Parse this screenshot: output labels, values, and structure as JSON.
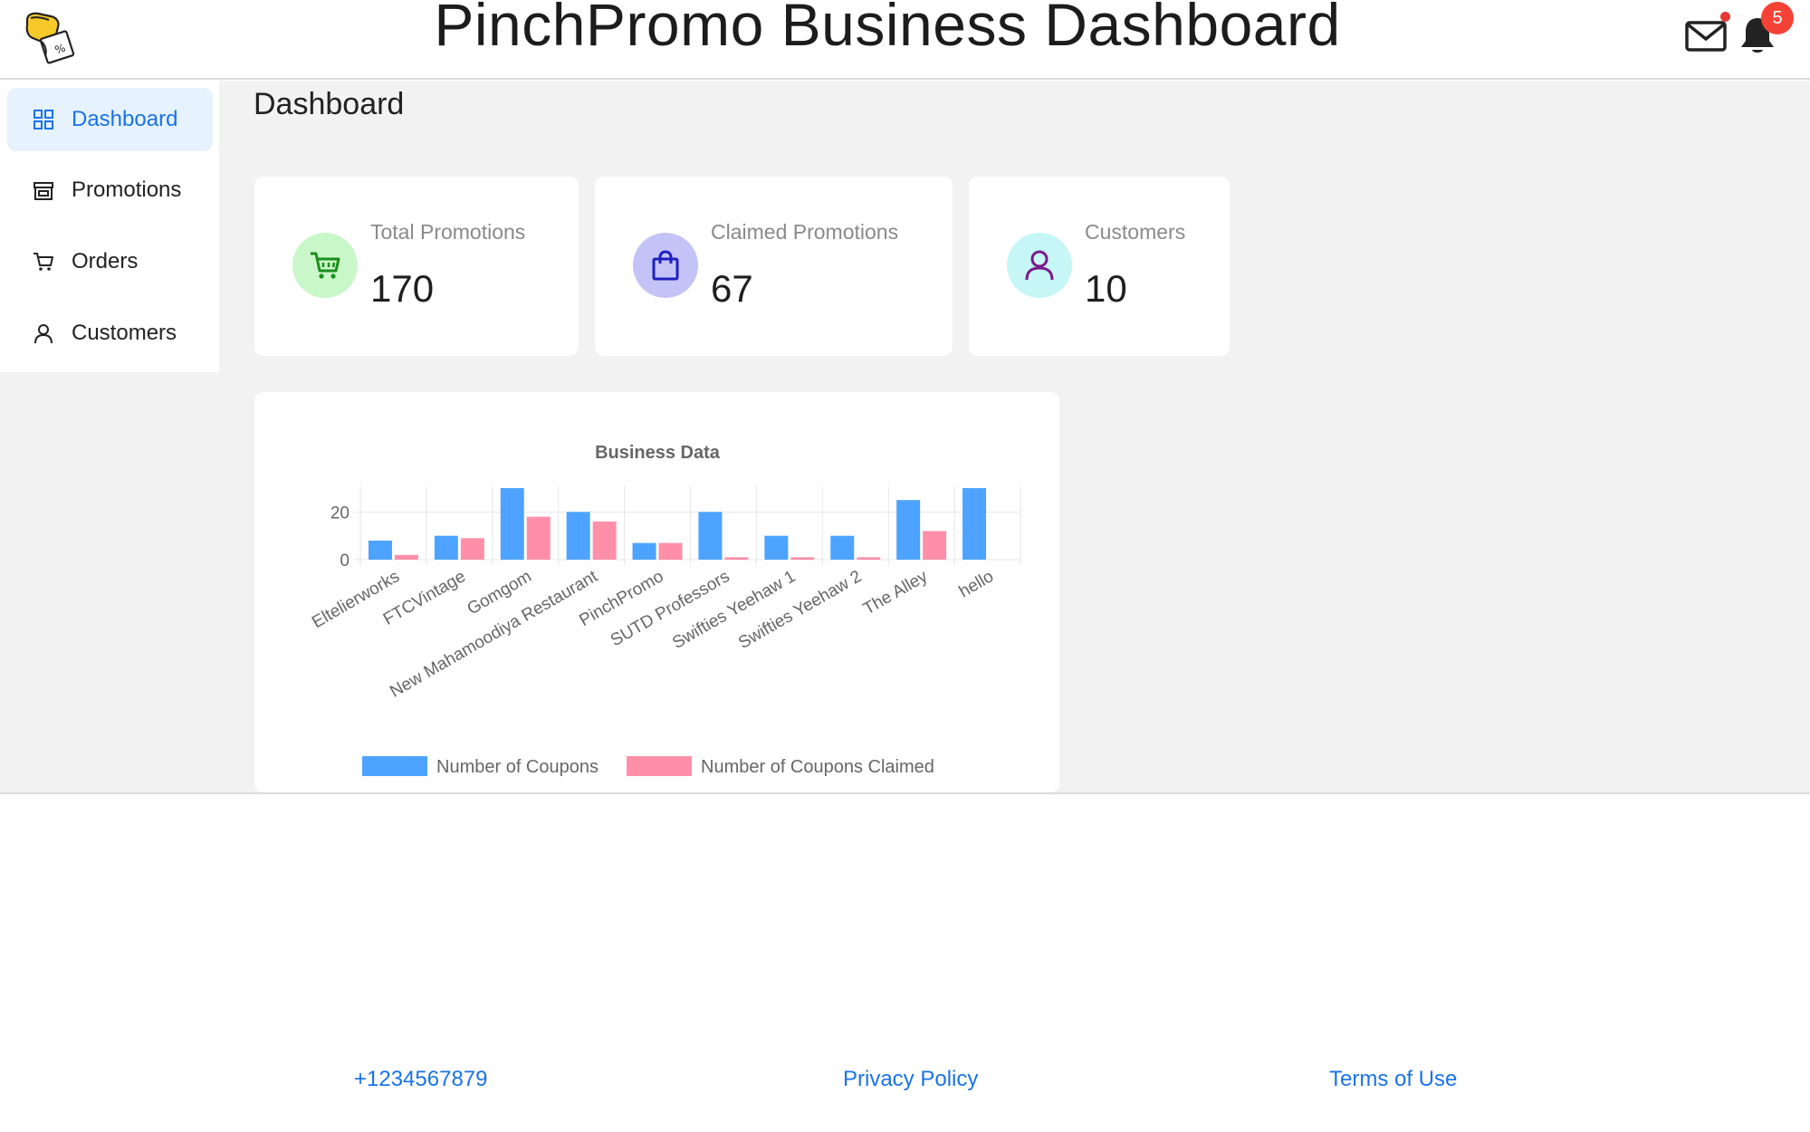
{
  "header": {
    "title": "PinchPromo Business Dashboard",
    "logo_icon": "hand-coupon-logo-icon",
    "mail_icon": "mail-icon",
    "notification_icon": "bell-icon",
    "notification_count": "5"
  },
  "sidebar": {
    "items": [
      {
        "label": "Dashboard",
        "icon": "grid-icon",
        "active": true
      },
      {
        "label": "Promotions",
        "icon": "store-icon",
        "active": false
      },
      {
        "label": "Orders",
        "icon": "cart-icon",
        "active": false
      },
      {
        "label": "Customers",
        "icon": "user-icon",
        "active": false
      }
    ]
  },
  "main": {
    "title": "Dashboard",
    "stats": [
      {
        "label": "Total Promotions",
        "value": "170",
        "icon": "cart-icon",
        "circle_color": "#c9f7c9",
        "icon_color": "#1b8f1b"
      },
      {
        "label": "Claimed Promotions",
        "value": "67",
        "icon": "shopping-bag-icon",
        "circle_color": "#c3c3f7",
        "icon_color": "#2020c0"
      },
      {
        "label": "Customers",
        "value": "10",
        "icon": "user-icon",
        "circle_color": "#c6f6f6",
        "icon_color": "#7a1a8a"
      }
    ]
  },
  "chart_data": {
    "type": "bar",
    "title": "Business Data",
    "categories": [
      "Eltelierworks",
      "FTCVintage",
      "Gomgom",
      "New Mahamoodiya Restaurant",
      "PinchPromo",
      "SUTD Professors",
      "Swifties Yeehaw 1",
      "Swifties Yeehaw 2",
      "The Alley",
      "hello"
    ],
    "series": [
      {
        "name": "Number of Coupons",
        "color": "#4da3ff",
        "values": [
          8,
          10,
          30,
          20,
          7,
          20,
          10,
          10,
          25,
          30
        ]
      },
      {
        "name": "Number of Coupons Claimed",
        "color": "#ff8fa8",
        "values": [
          2,
          9,
          18,
          16,
          7,
          1,
          1,
          1,
          12,
          0
        ]
      }
    ],
    "y_ticks": [
      "0",
      "20"
    ],
    "ylim": [
      0,
      30
    ],
    "grid": true,
    "legend_position": "bottom"
  },
  "footer": {
    "phone": "+1234567879",
    "privacy": "Privacy Policy",
    "terms": "Terms of Use"
  }
}
